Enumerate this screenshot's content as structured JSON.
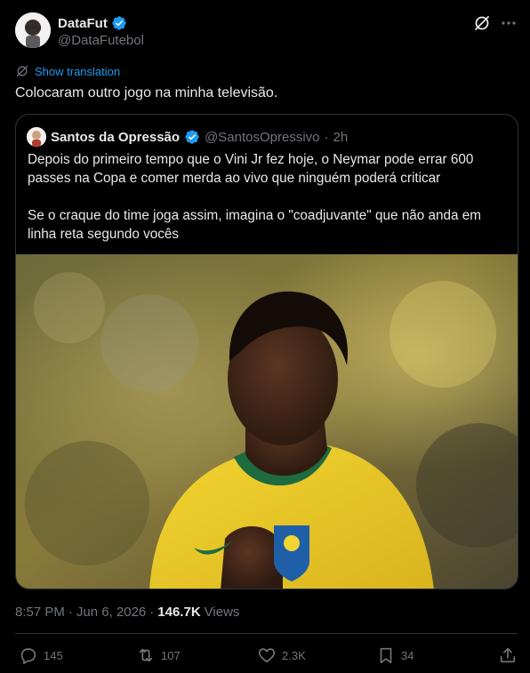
{
  "author": {
    "name": "DataFut",
    "handle": "@DataFutebol",
    "verified_color": "#1d9bf0"
  },
  "header_icons": [
    "grok-icon",
    "more-icon"
  ],
  "translate": {
    "label": "Show translation",
    "icon": "translate-icon"
  },
  "tweet": {
    "text": "Colocaram outro jogo na minha televisão."
  },
  "quote": {
    "name": "Santos da Opressão",
    "handle": "@SantosOpressivo",
    "separator": "·",
    "time": "2h",
    "text": "Depois do primeiro tempo que o Vini Jr fez hoje, o Neymar pode errar 600 passes na Copa e comer merda ao vivo que ninguém poderá criticar\n\nSe o craque do time joga assim, imagina o \"coadjuvante\" que não anda em linha reta segundo vocês"
  },
  "meta": {
    "time": "8:57 PM",
    "separator1": "·",
    "date": "Jun 6, 2026",
    "separator2": "·",
    "views_count": "146.7K",
    "views_label": "Views"
  },
  "actions": {
    "replies": "145",
    "reposts": "107",
    "likes": "2.3K",
    "bookmarks": "34"
  },
  "colors": {
    "background": "#000000",
    "text": "#e7e9ea",
    "muted": "#71767b",
    "accent": "#1d9bf0",
    "border": "#2f3336"
  }
}
